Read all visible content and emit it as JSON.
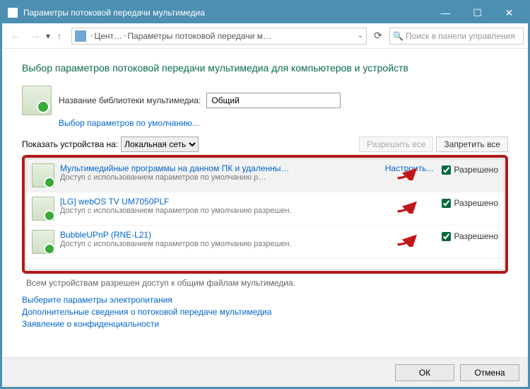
{
  "window": {
    "title": "Параметры потоковой передачи мультимедиа"
  },
  "nav": {
    "breadcrumb_1": "Цент…",
    "breadcrumb_2": "Параметры потоковой передачи м…",
    "search_placeholder": "Поиск в панели управления"
  },
  "header": "Выбор параметров потоковой передачи мультимедиа для компьютеров и устройств",
  "library": {
    "label": "Название библиотеки мультимедиа:",
    "value": "Общий",
    "defaults_link": "Выбор параметров по умолчанию..."
  },
  "show_devices": {
    "label": "Показать устройства на:",
    "scope": "Локальная сеть",
    "allow_all": "Разрешить все",
    "block_all": "Запретить все"
  },
  "devices": [
    {
      "title": "Мультимедийные программы на данном ПК и удаленны…",
      "sub": "Доступ с использованием параметров по умолчанию р…",
      "customize": "Настроить...",
      "allowed_label": "Разрешено",
      "checked": true,
      "selected": true
    },
    {
      "title": "[LG] webOS TV UM7050PLF",
      "sub": "Доступ с использованием параметров по умолчанию разрешен.",
      "customize": "",
      "allowed_label": "Разрешено",
      "checked": true,
      "selected": false
    },
    {
      "title": "BubbleUPnP (RNE-L21)",
      "sub": "Доступ с использованием параметров по умолчанию разрешен.",
      "customize": "",
      "allowed_label": "Разрешено",
      "checked": true,
      "selected": false
    }
  ],
  "status_line": "Всем устройствам разрешен доступ к общим файлам мультимедиа.",
  "links": {
    "power": "Выберите параметры электропитания",
    "more": "Дополнительные сведения о потоковой передаче мультимедиа",
    "privacy": "Заявление о конфиденциальности"
  },
  "footer": {
    "ok": "ОК",
    "cancel": "Отмена"
  }
}
